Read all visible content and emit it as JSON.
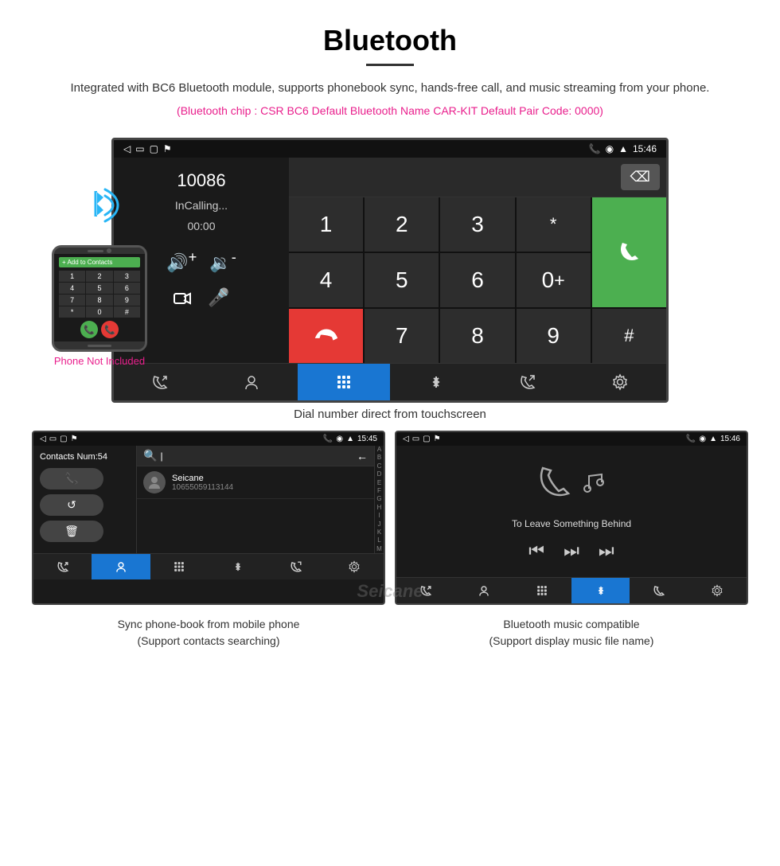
{
  "header": {
    "title": "Bluetooth",
    "description": "Integrated with BC6 Bluetooth module, supports phonebook sync, hands-free call, and music streaming from your phone.",
    "bluetooth_info": "(Bluetooth chip : CSR BC6    Default Bluetooth Name CAR-KIT    Default Pair Code: 0000)"
  },
  "main_screen": {
    "status_bar": {
      "left_icons": [
        "back",
        "home",
        "menu",
        "battery_flag"
      ],
      "right_icons": [
        "phone",
        "location",
        "wifi"
      ],
      "time": "15:46"
    },
    "number_display": "10086",
    "call_status": "InCalling...",
    "call_timer": "00:00",
    "keypad": [
      "1",
      "2",
      "3",
      "*",
      "4",
      "5",
      "6",
      "0+",
      "7",
      "8",
      "9",
      "#"
    ],
    "bottom_nav": [
      "call-transfer",
      "contacts",
      "keypad",
      "bluetooth",
      "phone-out",
      "settings"
    ]
  },
  "caption_main": "Dial number direct from touchscreen",
  "contacts_screen": {
    "status_time": "15:45",
    "contacts_count": "Contacts Num:54",
    "search_placeholder": "",
    "contact_name": "Seicane",
    "contact_number": "10655059113144",
    "alphabet": [
      "A",
      "B",
      "C",
      "D",
      "E",
      "F",
      "G",
      "H",
      "I",
      "J",
      "K",
      "L",
      "M"
    ],
    "bottom_nav_active": 1
  },
  "music_screen": {
    "status_time": "15:46",
    "song_title": "To Leave Something Behind",
    "bottom_nav_active": 3
  },
  "bottom_captions": {
    "left": "Sync phone-book from mobile phone\n(Support contacts searching)",
    "right": "Bluetooth music compatible\n(Support display music file name)"
  },
  "phone_not_included": "Phone Not Included",
  "watermark": "Seicane",
  "icons": {
    "phone": "📞",
    "bluetooth_wave": "◉",
    "search": "🔍",
    "call": "📞",
    "refresh": "↺",
    "delete": "🗑",
    "vol_up": "🔊+",
    "vol_down": "🔉-",
    "transfer": "↗",
    "mic": "🎤",
    "prev": "⏮",
    "play_pause": "⏭",
    "next": "⏭"
  }
}
